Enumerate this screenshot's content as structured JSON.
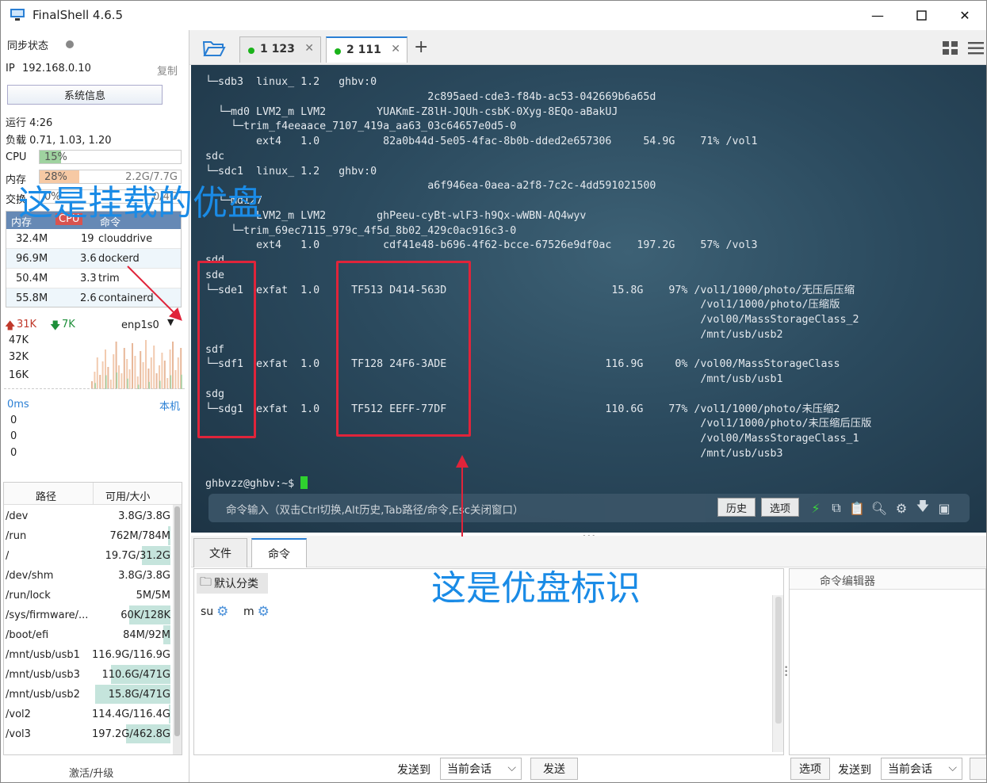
{
  "window": {
    "title": "FinalShell 4.6.5"
  },
  "left": {
    "sync_label": "同步状态",
    "ip_label": "IP",
    "ip_value": "192.168.0.10",
    "copy_label": "复制",
    "sysinfo_button": "系统信息",
    "uptime": "运行 4:26",
    "load": "负载 0.71, 1.03, 1.20",
    "cpu": {
      "label": "CPU",
      "text": "15%",
      "fraction": 0.15
    },
    "mem": {
      "label": "内存",
      "text": "28%",
      "right": "2.2G/7.7G",
      "fraction": 0.28
    },
    "swap": {
      "label": "交换",
      "text": "0%",
      "right": "0/4G",
      "fraction": 0.0
    },
    "proc_headers": [
      "内存",
      "CPU",
      "命令"
    ],
    "processes": [
      {
        "mem": "32.4M",
        "cpu": "19",
        "cmd": "clouddrive"
      },
      {
        "mem": "96.9M",
        "cpu": "3.6",
        "cmd": "dockerd"
      },
      {
        "mem": "50.4M",
        "cpu": "3.3",
        "cmd": "trim"
      },
      {
        "mem": "55.8M",
        "cpu": "2.6",
        "cmd": "containerd"
      }
    ],
    "net": {
      "up": "31K",
      "down": "7K",
      "iface": "enp1s0",
      "scale": [
        "47K",
        "32K",
        "16K"
      ]
    },
    "ping": {
      "label": "0ms",
      "host": "本机",
      "values": [
        "0",
        "0",
        "0"
      ]
    },
    "path_headers": [
      "路径",
      "可用/大小"
    ],
    "paths": [
      {
        "path": "/dev",
        "size": "3.8G/3.8G",
        "fraction": 0.0
      },
      {
        "path": "/run",
        "size": "762M/784M",
        "fraction": 0.03
      },
      {
        "path": "/",
        "size": "19.7G/31.2G",
        "fraction": 0.37
      },
      {
        "path": "/dev/shm",
        "size": "3.8G/3.8G",
        "fraction": 0.0
      },
      {
        "path": "/run/lock",
        "size": "5M/5M",
        "fraction": 0.0
      },
      {
        "path": "/sys/firmware/...",
        "size": "60K/128K",
        "fraction": 0.53
      },
      {
        "path": "/boot/efi",
        "size": "84M/92M",
        "fraction": 0.09
      },
      {
        "path": "/mnt/usb/usb1",
        "size": "116.9G/116.9G",
        "fraction": 0.0
      },
      {
        "path": "/mnt/usb/usb3",
        "size": "110.6G/471G",
        "fraction": 0.77
      },
      {
        "path": "/mnt/usb/usb2",
        "size": "15.8G/471G",
        "fraction": 0.97
      },
      {
        "path": "/vol2",
        "size": "114.4G/116.4G",
        "fraction": 0.02
      },
      {
        "path": "/vol3",
        "size": "197.2G/462.8G",
        "fraction": 0.57
      }
    ],
    "upgrade_label": "激活/升级"
  },
  "tabs": [
    {
      "label": "1 123",
      "active": false
    },
    {
      "label": "2 111",
      "active": true
    }
  ],
  "terminal": {
    "lines": [
      "└─sdb3  linux_ 1.2   ghbv:0",
      "                                   2c895aed-cde3-f84b-ac53-042669b6a65d",
      "  └─md0 LVM2_m LVM2        YUAKmE-Z8lH-JQUh-csbK-0Xyg-8EQo-aBakUJ",
      "    └─trim_f4eeaace_7107_419a_aa63_03c64657e0d5-0",
      "        ext4   1.0          82a0b44d-5e05-4fac-8b0b-dded2e657306     54.9G    71% /vol1",
      "sdc",
      "└─sdc1  linux_ 1.2   ghbv:0",
      "                                   a6f946ea-0aea-a2f8-7c2c-4dd591021500",
      "  └─md127",
      "        LVM2_m LVM2        ghPeeu-cyBt-wlF3-h9Qx-wWBN-AQ4wyv",
      "    └─trim_69ec7115_979c_4f5d_8b02_429c0ac916c3-0",
      "        ext4   1.0          cdf41e48-b696-4f62-bcce-67526e9df0ac    197.2G    57% /vol3",
      "sdd",
      "sde",
      "└─sde1  exfat  1.0     TF513 D414-563D                          15.8G    97% /vol1/1000/photo/无压后压缩",
      "                                                                              /vol1/1000/photo/压缩版",
      "                                                                              /vol00/MassStorageClass_2",
      "                                                                              /mnt/usb/usb2",
      "sdf",
      "└─sdf1  exfat  1.0     TF128 24F6-3ADE                         116.9G     0% /vol00/MassStorageClass",
      "                                                                              /mnt/usb/usb1",
      "sdg",
      "└─sdg1  exfat  1.0     TF512 EEFF-77DF                         110.6G    77% /vol1/1000/photo/未压缩2",
      "                                                                              /vol1/1000/photo/未压缩后压版",
      "                                                                              /vol00/MassStorageClass_1",
      "                                                                              /mnt/usb/usb3",
      "",
      "ghbvzz@ghbv:~$ "
    ],
    "cmd_placeholder": "命令输入（双击Ctrl切换,Alt历史,Tab路径/命令,Esc关闭窗口）",
    "history_button": "历史",
    "options_button": "选项"
  },
  "bottom": {
    "tabs": [
      "文件",
      "命令"
    ],
    "category": "默认分类",
    "commands": [
      {
        "label": "su"
      },
      {
        "label": "m"
      }
    ],
    "editor_title": "命令编辑器",
    "send_to_label": "发送到",
    "session_select": "当前会话",
    "send_button": "发送",
    "options_button": "选项",
    "send_to_label2": "发送到",
    "session_select2": "当前会话"
  },
  "annotations": {
    "mounted": "这是挂载的优盘",
    "usb_id": "这是优盘标识"
  },
  "colors": {
    "accent": "#2a7fd4",
    "annotation": "#1a8be6",
    "highlight_box": "#e0243a",
    "cpu_fill": "#9fd3a0",
    "mem_fill": "#f6c9a4"
  }
}
